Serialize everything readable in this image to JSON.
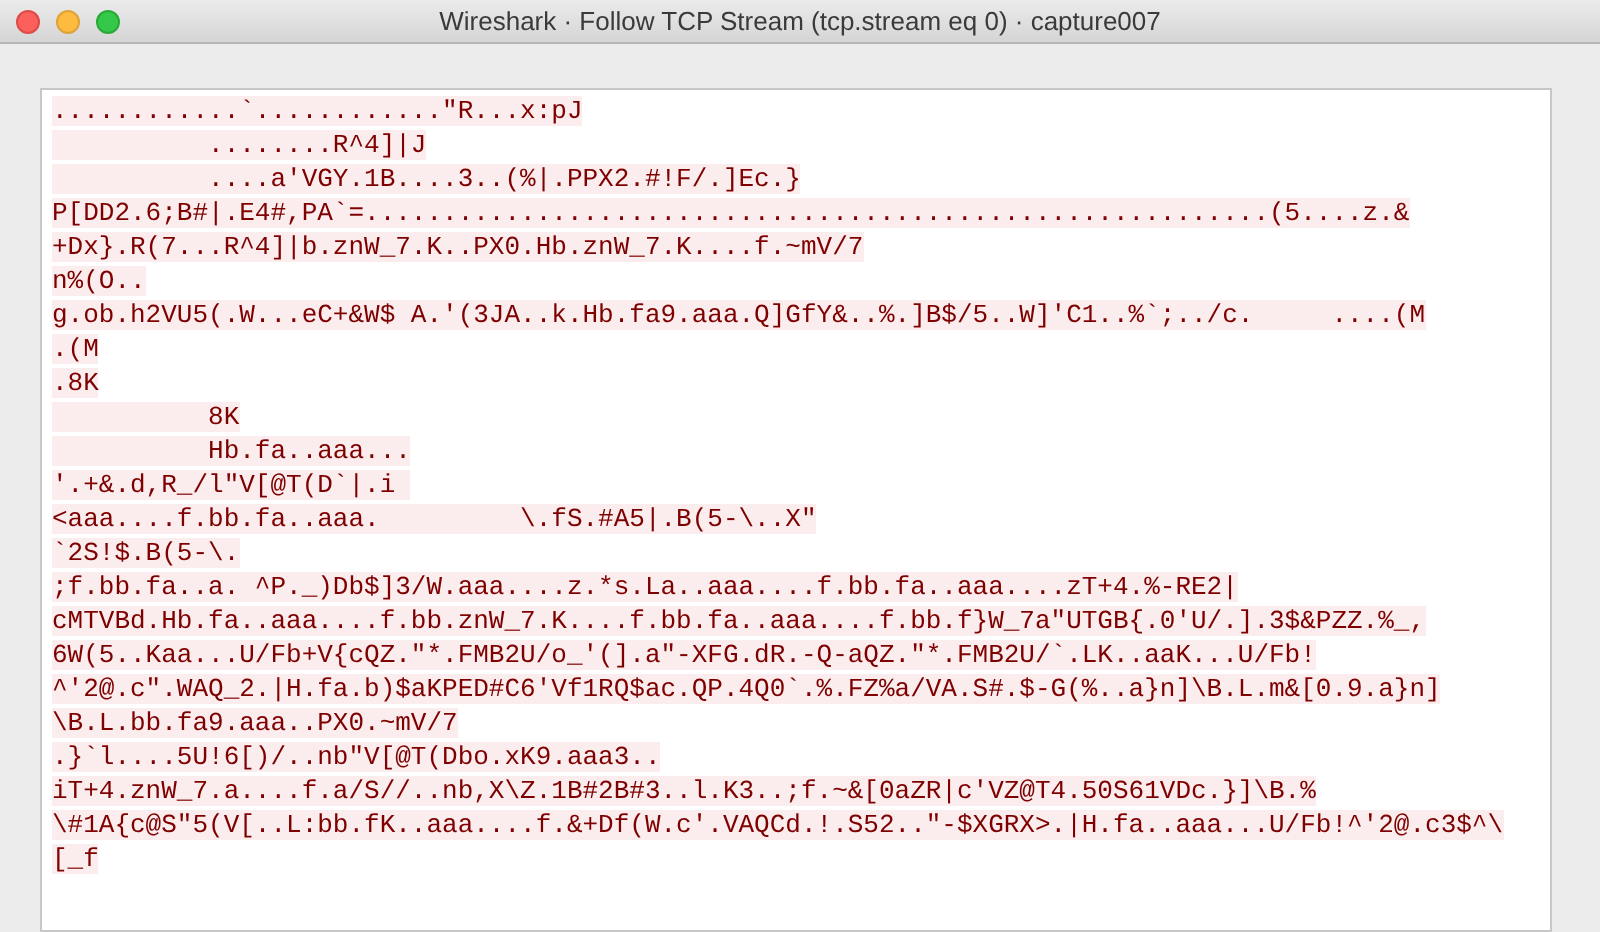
{
  "window": {
    "title": "Wireshark · Follow TCP Stream (tcp.stream eq 0) · capture007"
  },
  "stream": {
    "lines": [
      "............`............\"R...x:pJ",
      "          ........R^4]|J",
      "          ....a'VGY.1B....3..(%|.PPX2.#!F/.]Ec.}",
      "P[DD2.6;B#|.E4#,PA`=..........................................................(5....z.&",
      "+Dx}.R(7...R^4]|b.znW_7.K..PX0.Hb.znW_7.K....f.~mV/7",
      "n%(O..",
      "g.ob.h2VU5(.W...eC+&W$ A.'(3JA..k.Hb.fa9.aaa.Q]GfY&..%.]B$/5..W]'C1..%`;../c.     ....(M",
      ".(M",
      ".8K",
      "          8K",
      "          Hb.fa..aaa...",
      "'.+&.d,R_/l\"V[@T(D`|.i ",
      "<aaa....f.bb.fa..aaa.         \\.fS.#A5|.B(5-\\..X\"",
      "`2S!$.B(5-\\.",
      ";f.bb.fa..a. ^P._)Db$]3/W.aaa....z.*s.La..aaa....f.bb.fa..aaa....zT+4.%-RE2|",
      "cMTVBd.Hb.fa..aaa....f.bb.znW_7.K....f.bb.fa..aaa....f.bb.f}W_7a\"UTGB{.0'U/.].3$&PZZ.%_,",
      "6W(5..Kaa...U/Fb+V{cQZ.\"*.FMB2U/o_'(].a\"-XFG.dR.-Q-aQZ.\"*.FMB2U/`.LK..aaK...U/Fb!",
      "^'2@.c\".WAQ_2.|H.fa.b)$aKPED#C6'Vf1RQ$ac.QP.4Q0`.%.FZ%a/VA.S#.$-G(%..a}n]\\B.L.m&[0.9.a}n]",
      "\\B.L.bb.fa9.aaa..PX0.~mV/7",
      ".}`l....5U!6[)/..nb\"V[@T(Dbo.xK9.aaa3..",
      "iT+4.znW_7.a....f.a/S//..nb,X\\Z.1B#2B#3..l.K3..;f.~&[0aZR|c'VZ@T4.50S61VDc.}]\\B.%",
      "\\#1A{c@S\"5(V[..L:bb.fK..aaa....f.&+Df(W.c'.VAQCd.!.S52..\"-$XGRX>.|H.fa..aaa...U/Fb!^'2@.c3$^\\",
      "[_f"
    ]
  }
}
